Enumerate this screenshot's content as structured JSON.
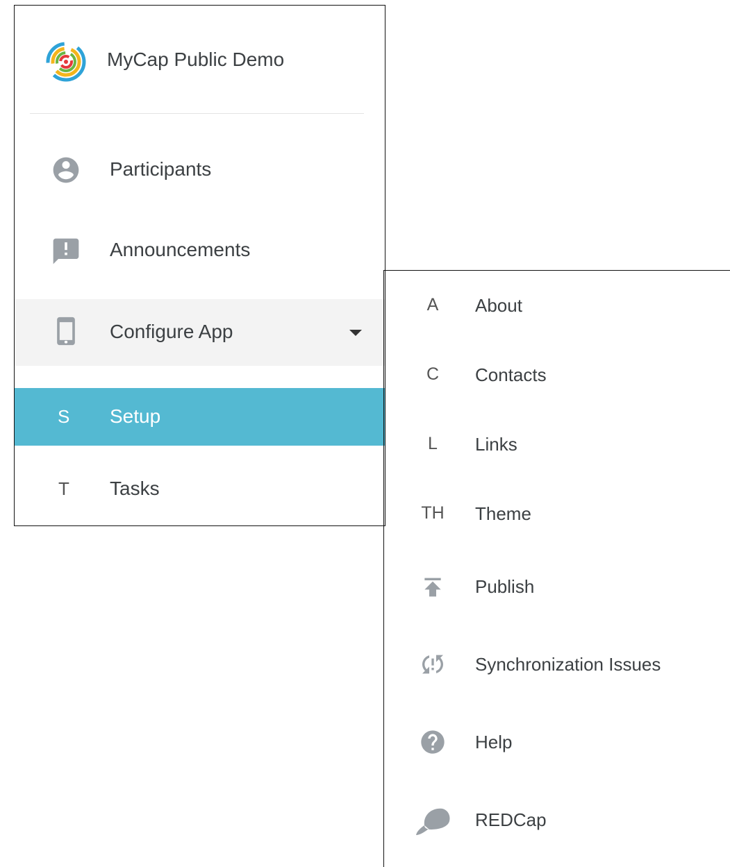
{
  "brand": {
    "title": "MyCap Public Demo",
    "logo_icon": "mycap-logo-icon"
  },
  "nav": {
    "participants": {
      "label": "Participants",
      "icon": "account-circle-icon"
    },
    "announcements": {
      "label": "Announcements",
      "icon": "announcement-icon"
    },
    "configure": {
      "label": "Configure App",
      "icon": "smartphone-icon",
      "expanded": true
    },
    "setup": {
      "letter": "S",
      "label": "Setup",
      "selected": true
    },
    "tasks": {
      "letter": "T",
      "label": "Tasks"
    }
  },
  "submenu": {
    "about": {
      "letter": "A",
      "label": "About"
    },
    "contacts": {
      "letter": "C",
      "label": "Contacts"
    },
    "links": {
      "letter": "L",
      "label": "Links"
    },
    "theme": {
      "letter": "TH",
      "label": "Theme"
    },
    "publish": {
      "label": "Publish",
      "icon": "publish-icon"
    },
    "sync": {
      "label": "Synchronization Issues",
      "icon": "sync-problem-icon"
    },
    "help": {
      "label": "Help",
      "icon": "help-icon"
    },
    "redcap": {
      "label": "REDCap",
      "icon": "redcap-icon"
    }
  },
  "colors": {
    "selected_bg": "#54b9d2",
    "hover_bg": "#f3f3f3",
    "icon_gray": "#9aa0a6",
    "text": "#3c4043"
  }
}
